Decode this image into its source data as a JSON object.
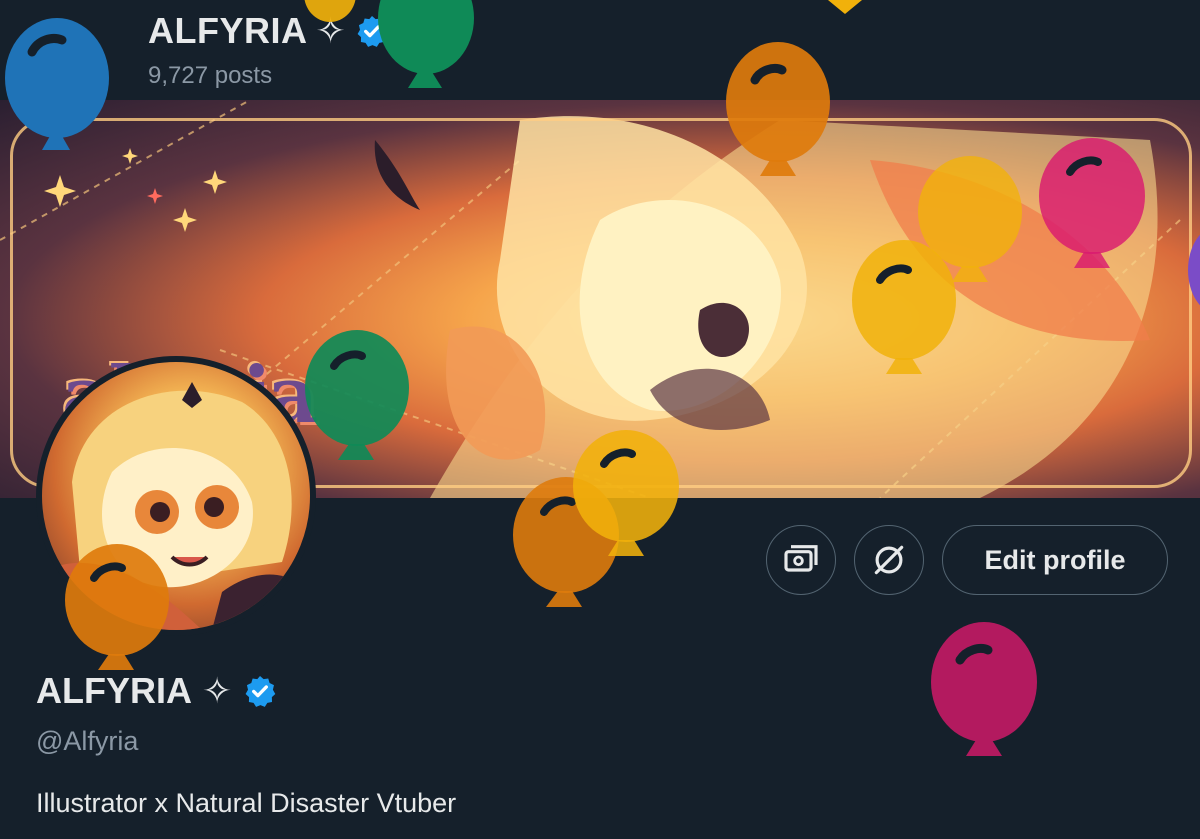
{
  "header": {
    "back_icon": "arrow-left-icon",
    "name": "ALFYRIA",
    "sparkle_symbol": "✧",
    "posts_count": "9,727 posts"
  },
  "banner": {
    "logo_text": "alfyria"
  },
  "actions": {
    "monetization_icon": "money-icon",
    "grok_icon": "slash-circle-icon",
    "edit_profile_label": "Edit profile"
  },
  "profile": {
    "name": "ALFYRIA",
    "sparkle_symbol": "✧",
    "verified_icon": "verified-badge-icon",
    "handle": "@Alfyria",
    "bio": "Illustrator x Natural Disaster Vtuber"
  },
  "colors": {
    "background": "#15202b",
    "text": "#e7e9ea",
    "muted": "#8b98a5",
    "verified": "#1d9bf0",
    "border": "#536471",
    "balloon_blue": "#1f73b7",
    "balloon_green": "#0f8a57",
    "balloon_orange": "#de7b0c",
    "balloon_yellow": "#f1b10b",
    "balloon_pink": "#d91a6f",
    "balloon_magenta": "#b31a5f"
  }
}
